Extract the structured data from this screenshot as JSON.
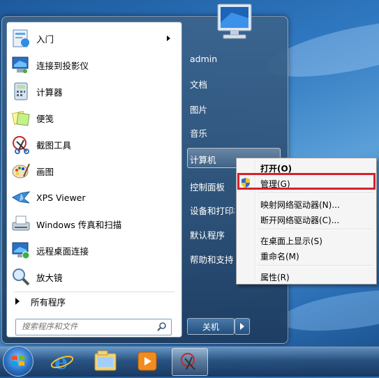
{
  "start_menu": {
    "programs": [
      {
        "label": "入门",
        "icon": "getting-started-icon",
        "has_submenu": true
      },
      {
        "label": "连接到投影仪",
        "icon": "projector-icon",
        "has_submenu": false
      },
      {
        "label": "计算器",
        "icon": "calculator-icon",
        "has_submenu": false
      },
      {
        "label": "便笺",
        "icon": "sticky-notes-icon",
        "has_submenu": false
      },
      {
        "label": "截图工具",
        "icon": "snipping-tool-icon",
        "has_submenu": false
      },
      {
        "label": "画图",
        "icon": "paint-icon",
        "has_submenu": false
      },
      {
        "label": "XPS Viewer",
        "icon": "xps-viewer-icon",
        "has_submenu": false
      },
      {
        "label": "Windows 传真和扫描",
        "icon": "fax-scan-icon",
        "has_submenu": false
      },
      {
        "label": "远程桌面连接",
        "icon": "remote-desktop-icon",
        "has_submenu": false
      },
      {
        "label": "放大镜",
        "icon": "magnifier-icon",
        "has_submenu": false
      }
    ],
    "all_programs_label": "所有程序",
    "search_placeholder": "搜索程序和文件",
    "right_items": {
      "user": "admin",
      "documents": "文档",
      "pictures": "图片",
      "music": "音乐",
      "computer": "计算机",
      "control_panel": "控制面板",
      "devices": "设备和打印机",
      "default_programs": "默认程序",
      "help": "帮助和支持"
    },
    "shutdown_label": "关机"
  },
  "context_menu": {
    "open": "打开(O)",
    "manage": "管理(G)",
    "map_drive": "映射网络驱动器(N)...",
    "disconnect_drive": "断开网络驱动器(C)...",
    "show_on_desktop": "在桌面上显示(S)",
    "rename": "重命名(M)",
    "properties": "属性(R)"
  },
  "taskbar": {
    "buttons": [
      "start-orb",
      "internet-explorer-icon",
      "windows-explorer-icon",
      "media-player-icon",
      "snipping-tool-icon"
    ]
  },
  "colors": {
    "highlight_box": "#d8202a"
  }
}
